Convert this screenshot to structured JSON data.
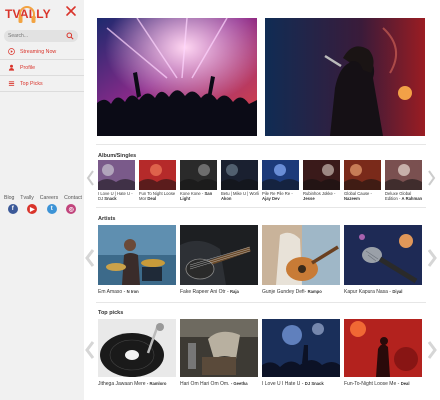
{
  "brand": {
    "logo_text": "TVALLY",
    "accent": "#d9342b"
  },
  "search": {
    "placeholder": "Search..."
  },
  "nav": [
    {
      "label": "Streaming Now",
      "icon": "play-icon"
    },
    {
      "label": "Profile",
      "icon": "user-icon"
    },
    {
      "label": "Top Picks",
      "icon": "list-icon"
    }
  ],
  "footer_links": [
    "Blog",
    "Tvally",
    "Careers",
    "Contact"
  ],
  "social": [
    {
      "name": "facebook-icon",
      "glyph": "f",
      "color": "#3b5998"
    },
    {
      "name": "youtube-icon",
      "glyph": "▶",
      "color": "#d9342b"
    },
    {
      "name": "twitter-icon",
      "glyph": "t",
      "color": "#3c93d6"
    },
    {
      "name": "instagram-icon",
      "glyph": "◎",
      "color": "#c1447c"
    }
  ],
  "sections": {
    "albums": {
      "title": "Album/Singles",
      "items": [
        {
          "title": "I Love U | Hate U - DJ",
          "artist": "Snack"
        },
        {
          "title": "Fun To Night Loose Mor",
          "artist": "Deal"
        },
        {
          "title": "Kone Kone -",
          "artist": "San Light"
        },
        {
          "title": "Betu | Mike U | Worli",
          "artist": "Akon"
        },
        {
          "title": "Pile Re Pile Re -",
          "artist": "Ajay Dev"
        },
        {
          "title": "Rubinhos Jokke -",
          "artist": "Jesse"
        },
        {
          "title": "Global Cause -",
          "artist": "Nazeem"
        },
        {
          "title": "Deluxe Global Edition -",
          "artist": "A Rahman"
        }
      ]
    },
    "artists": {
      "title": "Artists",
      "items": [
        {
          "title": "Em Amaso -",
          "artist": "N Iron"
        },
        {
          "title": "Fake Rapeer Ani Otr -",
          "artist": "Raja"
        },
        {
          "title": "Gunje Gundey Defi-",
          "artist": "Rampo"
        },
        {
          "title": "Kapur Kapura Nasa -",
          "artist": "Diyal"
        }
      ]
    },
    "top_picks": {
      "title": "Top picks",
      "items": [
        {
          "title": "Jithega Jawaan Mere",
          "artist": "- Ramloro"
        },
        {
          "title": "Hari Om Hari Om Om.",
          "artist": "- Geetha"
        },
        {
          "title": "I Love U I Hate U -",
          "artist": "DJ Snack"
        },
        {
          "title": "Fun-To-Night Loose Me -",
          "artist": "Deal"
        }
      ]
    }
  }
}
